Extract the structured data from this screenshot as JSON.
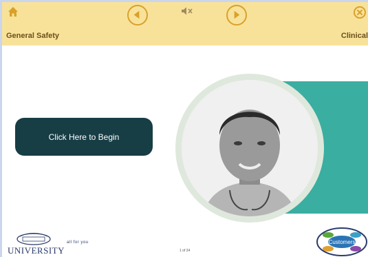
{
  "header": {
    "course_title": "General Safety",
    "section_title": "Clinical"
  },
  "main": {
    "begin_label": "Click Here to Begin"
  },
  "footer": {
    "university": "UNIVERSITY",
    "tagline": "all for you",
    "page_indicator": "1 of 24",
    "customers_label": "Customers"
  },
  "colors": {
    "topbar": "#f8e29a",
    "accent": "#d9a12a",
    "teal": "#3aaea0",
    "button": "#173d45"
  },
  "icons": [
    "home-icon",
    "previous-icon",
    "mute-icon",
    "next-icon",
    "close-icon"
  ]
}
